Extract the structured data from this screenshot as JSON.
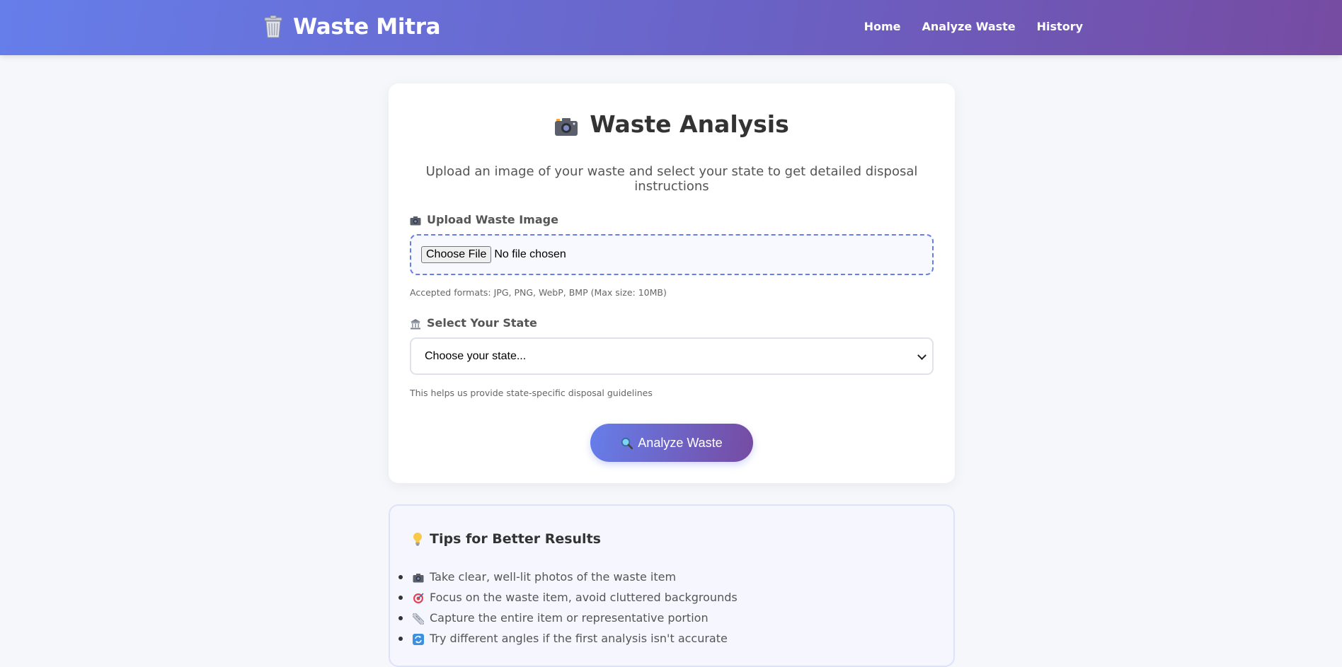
{
  "nav": {
    "brand": "Waste Mitra",
    "brand_icon": "trash-bin-icon",
    "links": [
      "Home",
      "Analyze Waste",
      "History"
    ]
  },
  "card": {
    "title": "Waste Analysis",
    "title_icon": "camera-icon",
    "subtitle": "Upload an image of your waste and select your state to get detailed disposal instructions",
    "upload_label": "Upload Waste Image",
    "file_button": "Choose File",
    "file_status": "No file chosen",
    "upload_hint": "Accepted formats: JPG, PNG, WebP, BMP (Max size: 10MB)",
    "state_label": "Select Your State",
    "state_select_value": "Choose your state...",
    "state_hint": "This helps us provide state-specific disposal guidelines",
    "analyze_button": "Analyze Waste"
  },
  "tips": {
    "title": "Tips for Better Results",
    "items": [
      {
        "icon": "camera-icon",
        "text": "Take clear, well-lit photos of the waste item"
      },
      {
        "icon": "target-icon",
        "text": "Focus on the waste item, avoid cluttered backgrounds"
      },
      {
        "icon": "ruler-icon",
        "text": "Capture the entire item or representative portion"
      },
      {
        "icon": "refresh-icon",
        "text": "Try different angles if the first analysis isn't accurate"
      }
    ]
  },
  "colors": {
    "primary": "#667eea",
    "secondary": "#764ba2",
    "background": "#f5f7fb"
  }
}
